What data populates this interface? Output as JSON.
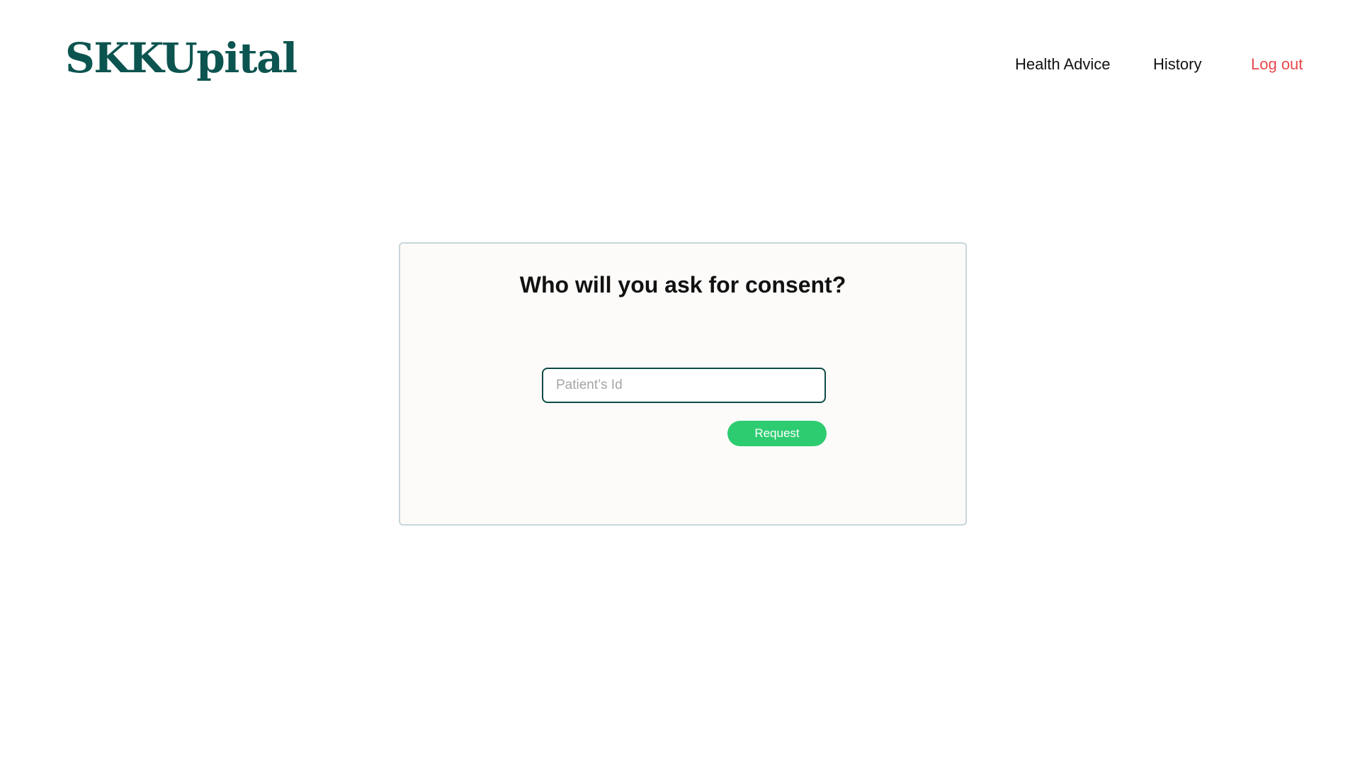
{
  "header": {
    "logo": "SKKUpital",
    "nav": {
      "health_advice": "Health Advice",
      "history": "History",
      "logout": "Log out"
    }
  },
  "consent_card": {
    "title": "Who will you ask for consent?",
    "patient_id": {
      "value": "",
      "placeholder": "Patient’s Id"
    },
    "request_button": "Request"
  },
  "colors": {
    "brand": "#0c5450",
    "logout": "#e8474b",
    "request_button": "#2ecc71",
    "card_border": "#c7d6da",
    "input_border": "#0f4b47"
  }
}
